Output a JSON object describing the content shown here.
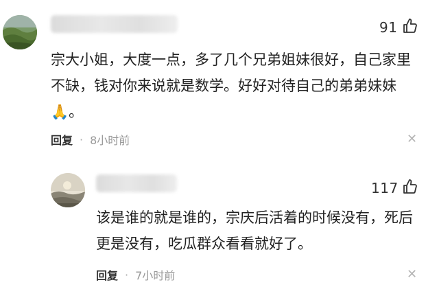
{
  "comments": [
    {
      "likes": "91",
      "text": "宗大小姐，大度一点，多了几个兄弟姐妹很好，自己家里不缺，钱对你来说就是数学。好好对待自己的弟弟妹妹🙏。",
      "reply_label": "回复",
      "time": "8小时前"
    },
    {
      "likes": "117",
      "text": "该是谁的就是谁的，宗庆后活着的时候没有，死后更是没有，吃瓜群众看看就好了。",
      "reply_label": "回复",
      "time": "7小时前"
    }
  ],
  "separator": "·",
  "icons": {
    "like": "thumbs-up-icon",
    "close": "close-icon"
  }
}
